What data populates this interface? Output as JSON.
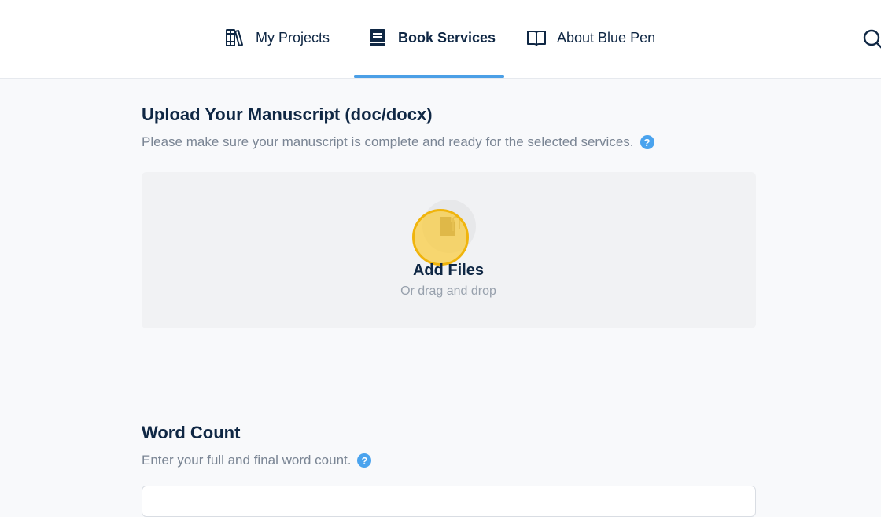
{
  "nav": {
    "projects_label": "My Projects",
    "services_label": "Book Services",
    "about_label": "About Blue Pen",
    "active_tab": "Book Services"
  },
  "upload": {
    "title": "Upload Your Manuscript (doc/docx)",
    "subtitle": "Please make sure your manuscript is complete and ready for the selected services.",
    "help": "?",
    "add_files": "Add Files",
    "drag_text": "Or drag and drop"
  },
  "word_count": {
    "title": "Word Count",
    "subtitle": "Enter your full and final word count.",
    "help": "?",
    "value": ""
  },
  "colors": {
    "accent": "#4b9fe6",
    "text": "#0f2744",
    "muted": "#7a8594",
    "highlight": "#facb3c"
  },
  "icons": [
    "books-icon",
    "book-icon",
    "open-book-icon",
    "search-icon",
    "help-icon",
    "file-attachment-icon"
  ]
}
